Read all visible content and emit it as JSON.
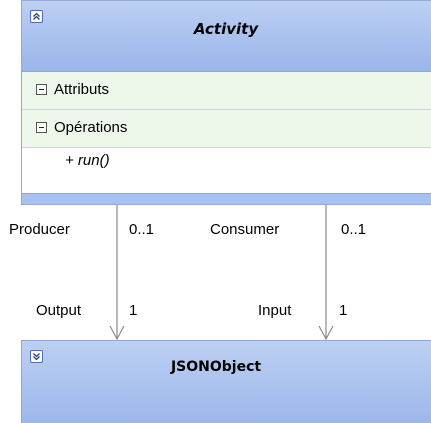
{
  "activity": {
    "title": "Activity",
    "sections": {
      "attributes_label": "Attributs",
      "operations_label": "Opérations"
    },
    "operations": [
      "+ run()"
    ]
  },
  "jsonobject": {
    "title": "JSONObject"
  },
  "associations": [
    {
      "source_role": "Producer",
      "source_multiplicity": "0..1",
      "target_role": "Output",
      "target_multiplicity": "1"
    },
    {
      "source_role": "Consumer",
      "source_multiplicity": "0..1",
      "target_role": "Input",
      "target_multiplicity": "1"
    }
  ],
  "colors": {
    "header": "#a9c1ee",
    "border": "#8faad8",
    "section_bg": "#eef8ea"
  }
}
